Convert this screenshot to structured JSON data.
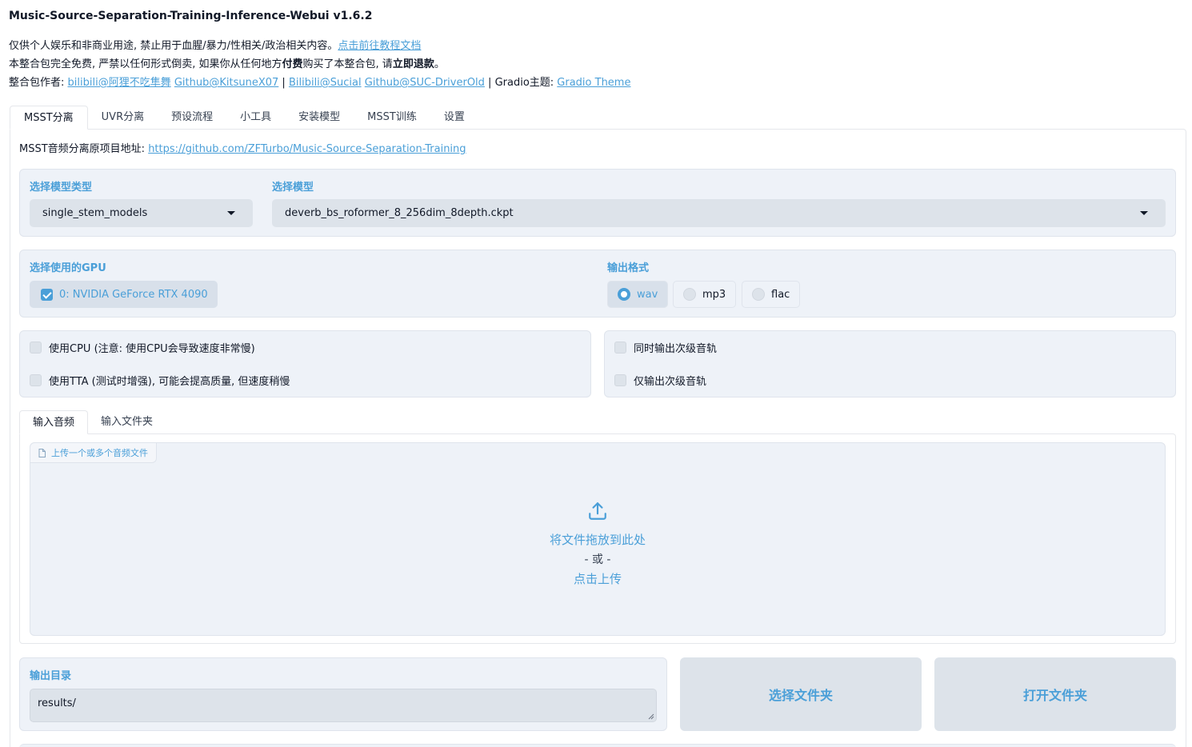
{
  "app": {
    "title": "Music-Source-Separation-Training-Inference-Webui v1.6.2"
  },
  "notice": {
    "line1_text": "仅供个人娱乐和非商业用途, 禁止用于血腥/暴力/性相关/政治相关内容。",
    "line1_link": "点击前往教程文档",
    "line2_a": "本整合包完全免费, 严禁以任何形式倒卖, 如果你从任何地方",
    "line2_b": "付费",
    "line2_c": "购买了本整合包, 请",
    "line2_d": "立即退款",
    "line2_e": "。",
    "line3_label": "整合包作者: ",
    "line3_links": [
      "bilibili@阿狸不吃隼舞",
      "Github@KitsuneX07",
      "Bilibili@Sucial",
      "Github@SUC-DriverOld"
    ],
    "sep": " | ",
    "gradio_label": "Gradio主题: ",
    "gradio_link": "Gradio Theme"
  },
  "tabs": [
    "MSST分离",
    "UVR分离",
    "预设流程",
    "小工具",
    "安装模型",
    "MSST训练",
    "设置"
  ],
  "source": {
    "label": "MSST音频分离原项目地址: ",
    "url": "https://github.com/ZFTurbo/Music-Source-Separation-Training"
  },
  "model_type": {
    "label": "选择模型类型",
    "value": "single_stem_models"
  },
  "model": {
    "label": "选择模型",
    "value": "deverb_bs_roformer_8_256dim_8depth.ckpt"
  },
  "gpu": {
    "label": "选择使用的GPU",
    "option": "0: NVIDIA GeForce RTX 4090"
  },
  "output_format": {
    "label": "输出格式",
    "options": [
      "wav",
      "mp3",
      "flac"
    ],
    "selected": "wav"
  },
  "options_left": [
    "使用CPU (注意: 使用CPU会导致速度非常慢)",
    "使用TTA (测试时增强), 可能会提高质量, 但速度稍慢"
  ],
  "options_right": [
    "同时输出次级音轨",
    "仅输出次级音轨"
  ],
  "input_tabs": [
    "输入音频",
    "输入文件夹"
  ],
  "upload": {
    "badge": "上传一个或多个音频文件",
    "drop_text": "将文件拖放到此处",
    "or_text": "- 或 -",
    "click_text": "点击上传"
  },
  "output_dir": {
    "label": "输出目录",
    "value": "results/"
  },
  "buttons": {
    "select_folder": "选择文件夹",
    "open_folder": "打开文件夹"
  },
  "colors": {
    "accent": "#4a9fd8",
    "block_bg": "#eef2f8",
    "control_bg": "#dde3ea"
  }
}
